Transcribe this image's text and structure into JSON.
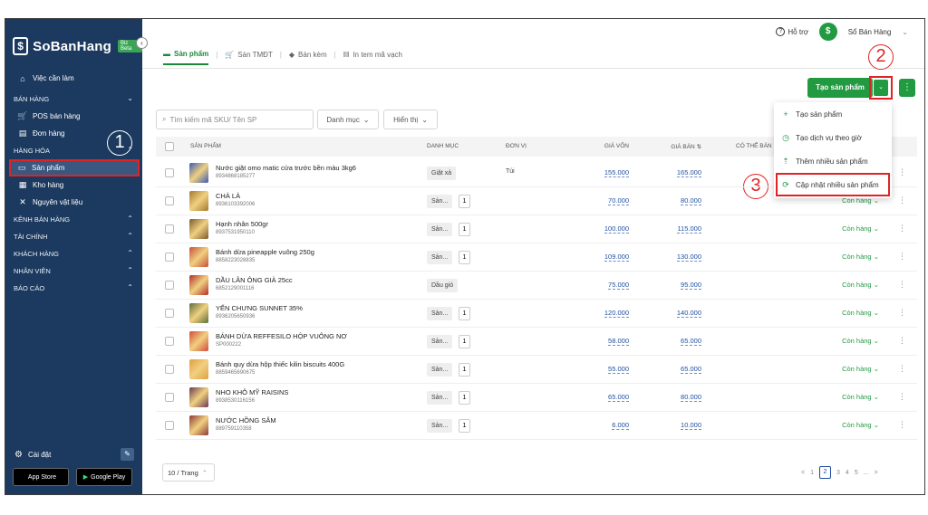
{
  "brand": {
    "name": "SoBanHang",
    "badge": "Biz Beta"
  },
  "sidebar": {
    "items": [
      {
        "icon": "home-icon",
        "glyph": "⌂",
        "label": "Việc cần làm",
        "type": "item"
      },
      {
        "label": "BÁN HÀNG",
        "type": "section",
        "chev": "⌄"
      },
      {
        "icon": "cart-icon",
        "glyph": "🛒",
        "label": "POS bán hàng",
        "type": "sub"
      },
      {
        "icon": "document-icon",
        "glyph": "▤",
        "label": "Đơn hàng",
        "type": "sub"
      },
      {
        "label": "HÀNG HÓA",
        "type": "section",
        "chev": "⌃"
      },
      {
        "icon": "product-icon",
        "glyph": "▭",
        "label": "Sản phẩm",
        "type": "active"
      },
      {
        "icon": "warehouse-icon",
        "glyph": "▦",
        "label": "Kho hàng",
        "type": "sub"
      },
      {
        "icon": "tools-icon",
        "glyph": "✕",
        "label": "Nguyên vật liệu",
        "type": "sub"
      },
      {
        "label": "KÊNH BÁN HÀNG",
        "type": "section",
        "chev": "⌃"
      },
      {
        "label": "TÀI CHÍNH",
        "type": "section",
        "chev": "⌃"
      },
      {
        "label": "KHÁCH HÀNG",
        "type": "section",
        "chev": "⌃"
      },
      {
        "label": "NHÂN VIÊN",
        "type": "section",
        "chev": "⌃"
      },
      {
        "label": "BÁO CÁO",
        "type": "section",
        "chev": "⌃"
      }
    ],
    "settings": "Cài đặt",
    "app_store": "App Store",
    "google_play": "Google Play"
  },
  "header": {
    "help": "Hỗ trợ",
    "account": "Sổ Bán Hàng"
  },
  "tabs": [
    "Sản phẩm",
    "Sàn TMĐT",
    "Bán kèm",
    "In tem mã vạch"
  ],
  "actions": {
    "create": "Tạo sản phẩm"
  },
  "menu": [
    "Tạo sản phẩm",
    "Tạo dịch vụ theo giờ",
    "Thêm nhiều sản phẩm",
    "Cập nhật nhiều sản phẩm"
  ],
  "annotations": [
    "1",
    "2",
    "3"
  ],
  "filters": {
    "search_placeholder": "Tìm kiếm mã SKU/ Tên SP",
    "category": "Danh mục",
    "display": "Hiển thị"
  },
  "table": {
    "headers": {
      "product": "SẢN PHẨM",
      "category": "DANH MỤC",
      "unit": "ĐƠN VỊ",
      "cost": "GIÁ VỐN",
      "price": "GIÁ BÁN",
      "sellable": "CÓ THỂ BÁN"
    },
    "rows": [
      {
        "name": "Nước giặt omo matic cửa trước bền màu 3kg6",
        "sku": "8934868185277",
        "category": "Giặt xả",
        "count": "",
        "unit": "Túi",
        "cost": "155.000",
        "price": "165.000",
        "stock": "",
        "color": "#3b5bb5"
      },
      {
        "name": "CHÀ LÀ",
        "sku": "8936103392006",
        "category": "Sản...",
        "count": "1",
        "unit": "",
        "cost": "70.000",
        "price": "80.000",
        "stock": "Còn hàng",
        "color": "#a5782f"
      },
      {
        "name": "Hạnh nhân 500gr",
        "sku": "8937531950110",
        "category": "Sản...",
        "count": "1",
        "unit": "",
        "cost": "100.000",
        "price": "115.000",
        "stock": "Còn hàng",
        "color": "#7a5a2e"
      },
      {
        "name": "Bánh dừa pineapple vuông 250g",
        "sku": "8858223028835",
        "category": "Sản...",
        "count": "1",
        "unit": "",
        "cost": "109.000",
        "price": "130.000",
        "stock": "Còn hàng",
        "color": "#c65038"
      },
      {
        "name": "DẦU LÂN ÔNG GIÀ 25cc",
        "sku": "6852129001116",
        "category": "Dầu gió",
        "count": "",
        "unit": "",
        "cost": "75.000",
        "price": "95.000",
        "stock": "Còn hàng",
        "color": "#b22e2e"
      },
      {
        "name": "YẾN CHƯNG SUNNET 35%",
        "sku": "8936205650936",
        "category": "Sản...",
        "count": "1",
        "unit": "",
        "cost": "120.000",
        "price": "140.000",
        "stock": "Còn hàng",
        "color": "#5d6f3b"
      },
      {
        "name": "BÁNH DỪA REFFESILO HỘP VUÔNG NƠ",
        "sku": "SP000222",
        "category": "Sản...",
        "count": "1",
        "unit": "",
        "cost": "58.000",
        "price": "65.000",
        "stock": "Còn hàng",
        "color": "#d44a3a"
      },
      {
        "name": "Bánh quy dừa hộp thiếc kilin biscuits 400G",
        "sku": "8859465690675",
        "category": "Sản...",
        "count": "1",
        "unit": "",
        "cost": "55.000",
        "price": "65.000",
        "stock": "Còn hàng",
        "color": "#e0a040"
      },
      {
        "name": "NHO KHÔ MỸ RAISINS",
        "sku": "8938530116156",
        "category": "Sản...",
        "count": "1",
        "unit": "",
        "cost": "65.000",
        "price": "80.000",
        "stock": "Còn hàng",
        "color": "#6b3a52"
      },
      {
        "name": "NƯỚC HỒNG SÂM",
        "sku": "889759110358",
        "category": "Sản...",
        "count": "1",
        "unit": "",
        "cost": "6.000",
        "price": "10.000",
        "stock": "Còn hàng",
        "color": "#8c3a3a"
      }
    ]
  },
  "footer": {
    "page_size": "10 / Trang",
    "pages": [
      "1",
      "2",
      "3",
      "4",
      "5",
      "..."
    ],
    "current_page": "2",
    "prev": "<",
    "next": ">"
  }
}
